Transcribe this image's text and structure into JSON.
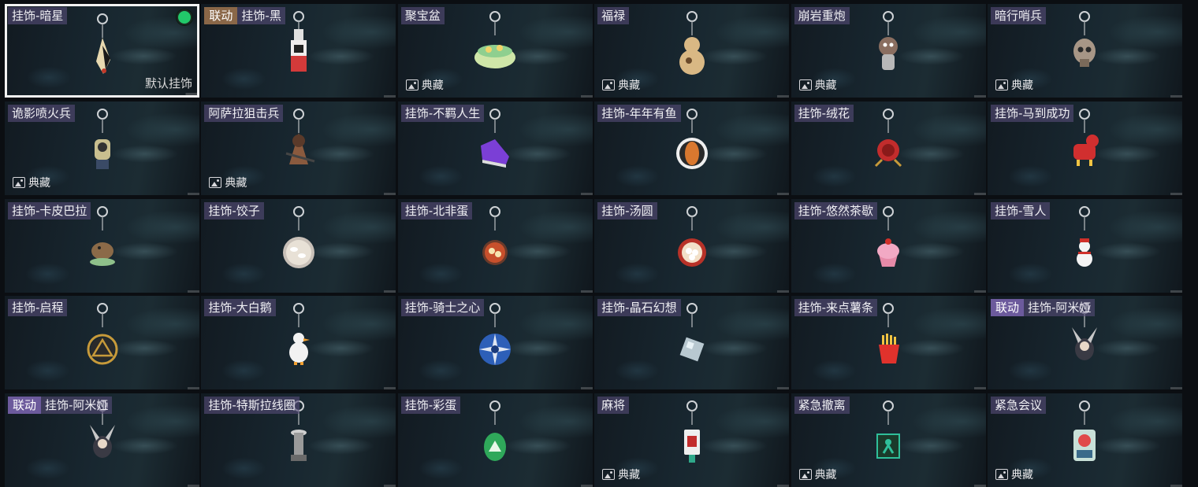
{
  "cards": [
    {
      "tag": "",
      "tag_color": "",
      "name": "挂饰-暗星",
      "collect": "",
      "default": "默认挂饰",
      "selected": true,
      "equipped": true,
      "charm_icon": "dark-star-charm",
      "charm_color": "#e8d9b0"
    },
    {
      "tag": "联动",
      "tag_color": "orange",
      "name": "挂饰-黑",
      "collect": "",
      "default": "",
      "charm_icon": "black-tag-charm",
      "charm_color": "#d33a3a"
    },
    {
      "tag": "",
      "name": "聚宝盆",
      "collect": "典藏",
      "charm_icon": "treasure-bowl-charm",
      "charm_color": "#cfe6a8"
    },
    {
      "tag": "",
      "name": "福禄",
      "collect": "典藏",
      "charm_icon": "gourd-charm",
      "charm_color": "#d9b884"
    },
    {
      "tag": "",
      "name": "崩岩重炮",
      "collect": "典藏",
      "charm_icon": "rock-gunner-charm",
      "charm_color": "#8a6e60"
    },
    {
      "tag": "",
      "name": "暗行哨兵",
      "collect": "典藏",
      "charm_icon": "skull-sentinel-charm",
      "charm_color": "#a79686"
    },
    {
      "tag": "",
      "name": "诡影喷火兵",
      "collect": "典藏",
      "charm_icon": "flamethrower-charm",
      "charm_color": "#c9bf8f"
    },
    {
      "tag": "",
      "name": "阿萨拉狙击兵",
      "collect": "典藏",
      "charm_icon": "sniper-charm",
      "charm_color": "#8a5a3e"
    },
    {
      "tag": "",
      "name": "挂饰-不羁人生",
      "collect": "",
      "charm_icon": "sneaker-charm",
      "charm_color": "#7b3fd6"
    },
    {
      "tag": "",
      "name": "挂饰-年年有鱼",
      "collect": "",
      "charm_icon": "fish-plate-charm",
      "charm_color": "#d9782f"
    },
    {
      "tag": "",
      "name": "挂饰-绒花",
      "collect": "",
      "charm_icon": "rose-charm",
      "charm_color": "#c22c2c"
    },
    {
      "tag": "",
      "name": "挂饰-马到成功",
      "collect": "",
      "charm_icon": "horse-charm",
      "charm_color": "#d12f2f"
    },
    {
      "tag": "",
      "name": "挂饰-卡皮巴拉",
      "collect": "",
      "charm_icon": "capybara-charm",
      "charm_color": "#8b6a48"
    },
    {
      "tag": "",
      "name": "挂饰-饺子",
      "collect": "",
      "charm_icon": "dumpling-charm",
      "charm_color": "#e8e1d6"
    },
    {
      "tag": "",
      "name": "挂饰-北非蛋",
      "collect": "",
      "charm_icon": "shakshuka-charm",
      "charm_color": "#c8502c"
    },
    {
      "tag": "",
      "name": "挂饰-汤圆",
      "collect": "",
      "charm_icon": "tangyuan-charm",
      "charm_color": "#b83228"
    },
    {
      "tag": "",
      "name": "挂饰-悠然茶歇",
      "collect": "",
      "charm_icon": "cupcake-charm",
      "charm_color": "#f2a9c4"
    },
    {
      "tag": "",
      "name": "挂饰-雪人",
      "collect": "",
      "charm_icon": "snowman-charm",
      "charm_color": "#f4f4f4"
    },
    {
      "tag": "",
      "name": "挂饰-启程",
      "collect": "",
      "charm_icon": "triangle-medal-charm",
      "charm_color": "#c79a3a"
    },
    {
      "tag": "",
      "name": "挂饰-大白鹅",
      "collect": "",
      "charm_icon": "goose-charm",
      "charm_color": "#f2f2f2"
    },
    {
      "tag": "",
      "name": "挂饰-骑士之心",
      "collect": "",
      "charm_icon": "knight-emblem-charm",
      "charm_color": "#2d5fb8"
    },
    {
      "tag": "",
      "name": "挂饰-晶石幻想",
      "collect": "",
      "charm_icon": "crystal-cube-charm",
      "charm_color": "#b8c8d0"
    },
    {
      "tag": "",
      "name": "挂饰-来点薯条",
      "collect": "",
      "charm_icon": "fries-charm",
      "charm_color": "#e0322c"
    },
    {
      "tag": "联动",
      "tag_color": "purple",
      "name": "挂饰-阿米娅",
      "collect": "",
      "charm_icon": "amiya-charm",
      "charm_color": "#3a3a44"
    },
    {
      "tag": "联动",
      "tag_color": "purple",
      "name": "挂饰-阿米娅",
      "collect": "",
      "charm_icon": "amiya-charm",
      "charm_color": "#3a3a44"
    },
    {
      "tag": "",
      "name": "挂饰-特斯拉线圈",
      "collect": "",
      "charm_icon": "tesla-coil-charm",
      "charm_color": "#9a9a9a"
    },
    {
      "tag": "",
      "name": "挂饰-彩蛋",
      "collect": "",
      "charm_icon": "easter-egg-charm",
      "charm_color": "#2fa85a"
    },
    {
      "tag": "",
      "name": "麻将",
      "collect": "典藏",
      "charm_icon": "mahjong-tile-charm",
      "charm_color": "#eeeeee"
    },
    {
      "tag": "",
      "name": "紧急撤离",
      "collect": "典藏",
      "charm_icon": "evac-sign-charm",
      "charm_color": "#2fbf9a"
    },
    {
      "tag": "",
      "name": "紧急会议",
      "collect": "典藏",
      "charm_icon": "emergency-meeting-charm",
      "charm_color": "#c8e0d8"
    }
  ]
}
